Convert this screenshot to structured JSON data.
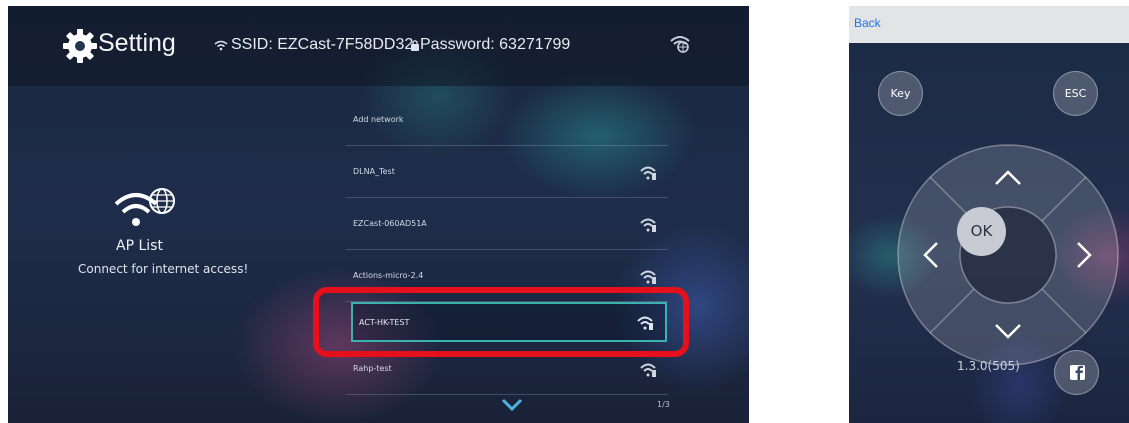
{
  "tv": {
    "title": "Setting",
    "ssid_label": "SSID: EZCast-7F58DD32",
    "password_label": "Password: 63271799",
    "ap_panel": {
      "title": "AP List",
      "subtitle": "Connect for internet access!"
    },
    "networks": [
      {
        "name": "Add network"
      },
      {
        "name": "DLNA_Test"
      },
      {
        "name": "EZCast-060AD51A"
      },
      {
        "name": "Actions-micro-2.4"
      },
      {
        "name": "ACT-HK-TEST"
      },
      {
        "name": "Rahp-test"
      }
    ],
    "selected_index": 4,
    "page_indicator": "1/3"
  },
  "phone": {
    "back_label": "Back",
    "key_label": "Key",
    "esc_label": "ESC",
    "ok_label": "OK",
    "version": "1.3.0(505)"
  },
  "colors": {
    "highlight_red": "#e5101b",
    "selection_teal": "#3ab2b0",
    "ios_blue": "#1d73e8"
  },
  "icons": [
    "gear-icon",
    "wifi-globe-icon",
    "wifi-signal-icon",
    "chevron-down-icon",
    "lock-icon",
    "facebook-icon"
  ]
}
